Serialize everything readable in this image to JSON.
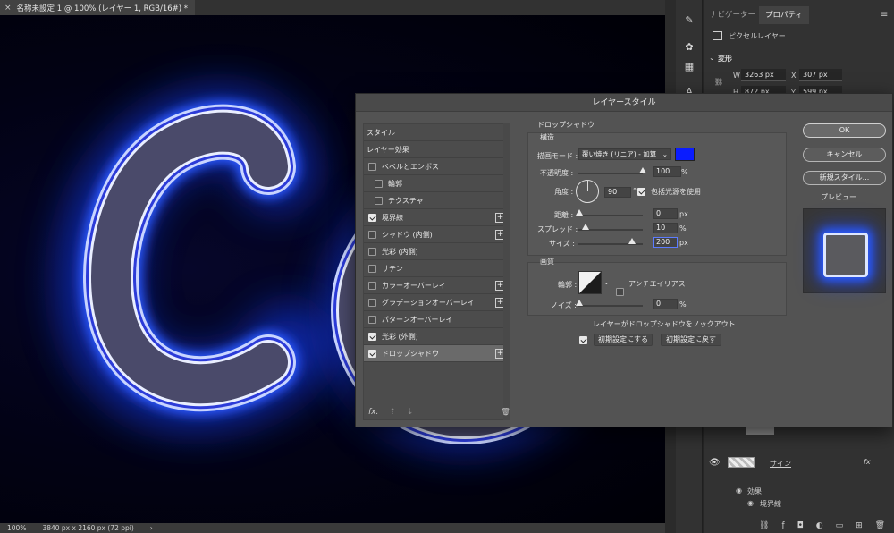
{
  "document": {
    "close_glyph": "×",
    "tab_title": "名称未設定 1 @ 100% (レイヤー 1, RGB/16#) *"
  },
  "status_bar": {
    "zoom": "100%",
    "doc_info": "3840 px x 2160 px (72 ppi)",
    "arrow": "›"
  },
  "right_panel": {
    "tabs": [
      "ナビゲーター",
      "プロパティ"
    ],
    "active_tab": 1,
    "menu_glyph": "≡",
    "layer_kind": "ピクセルレイヤー",
    "transform_label": "変形",
    "w_label": "W",
    "w_value": "3263 px",
    "x_label": "X",
    "x_value": "307 px",
    "h_label": "H",
    "h_value": "872 px",
    "y_label": "Y",
    "y_value": "599 px"
  },
  "layers": {
    "layer_name": "サイン",
    "fx": "fx",
    "effects_label": "効果",
    "effect_item": "境界線"
  },
  "dialog": {
    "title": "レイヤースタイル",
    "list_header": "スタイル",
    "list_subheader": "レイヤー効果",
    "styles": [
      {
        "label": "ベベルとエンボス",
        "checked": false,
        "plus": false,
        "indent": false
      },
      {
        "label": "輪郭",
        "checked": false,
        "plus": false,
        "indent": true
      },
      {
        "label": "テクスチャ",
        "checked": false,
        "plus": false,
        "indent": true
      },
      {
        "label": "境界線",
        "checked": true,
        "plus": true,
        "indent": false
      },
      {
        "label": "シャドウ (内側)",
        "checked": false,
        "plus": true,
        "indent": false
      },
      {
        "label": "光彩 (内側)",
        "checked": false,
        "plus": false,
        "indent": false
      },
      {
        "label": "サテン",
        "checked": false,
        "plus": false,
        "indent": false
      },
      {
        "label": "カラーオーバーレイ",
        "checked": false,
        "plus": true,
        "indent": false
      },
      {
        "label": "グラデーションオーバーレイ",
        "checked": false,
        "plus": true,
        "indent": false
      },
      {
        "label": "パターンオーバーレイ",
        "checked": false,
        "plus": false,
        "indent": false
      },
      {
        "label": "光彩 (外側)",
        "checked": true,
        "plus": false,
        "indent": false
      },
      {
        "label": "ドロップシャドウ",
        "checked": true,
        "plus": true,
        "indent": false,
        "selected": true
      }
    ],
    "footer": {
      "fx": "fx.",
      "up": "⇡",
      "down": "⇣",
      "trash": "🗑"
    },
    "section_title": "ドロップシャドウ",
    "structure": {
      "title": "構造",
      "blend_label": "描画モード :",
      "blend_value": "覆い焼き (リニア) - 加算",
      "color": "#0a1cff",
      "opacity_label": "不透明度 :",
      "opacity_value": "100",
      "opacity_unit": "%",
      "angle_label": "角度 :",
      "angle_value": "90",
      "angle_unit": "°",
      "global_light_label": "包括光源を使用",
      "global_light": true,
      "distance_label": "距離 :",
      "distance_value": "0",
      "distance_unit": "px",
      "spread_label": "スプレッド :",
      "spread_value": "10",
      "spread_unit": "%",
      "size_label": "サイズ :",
      "size_value": "200",
      "size_unit": "px"
    },
    "quality": {
      "title": "画質",
      "contour_label": "輪郭 :",
      "antialias_label": "アンチエイリアス",
      "antialias": false,
      "noise_label": "ノイズ :",
      "noise_value": "0",
      "noise_unit": "%"
    },
    "knockout_label": "レイヤーがドロップシャドウをノックアウト",
    "knockout": true,
    "reset_default": "初期設定にする",
    "restore_default": "初期設定に戻す",
    "ok": "OK",
    "cancel": "キャンセル",
    "new_style": "新規スタイル...",
    "preview_label": "プレビュー",
    "preview": true
  }
}
